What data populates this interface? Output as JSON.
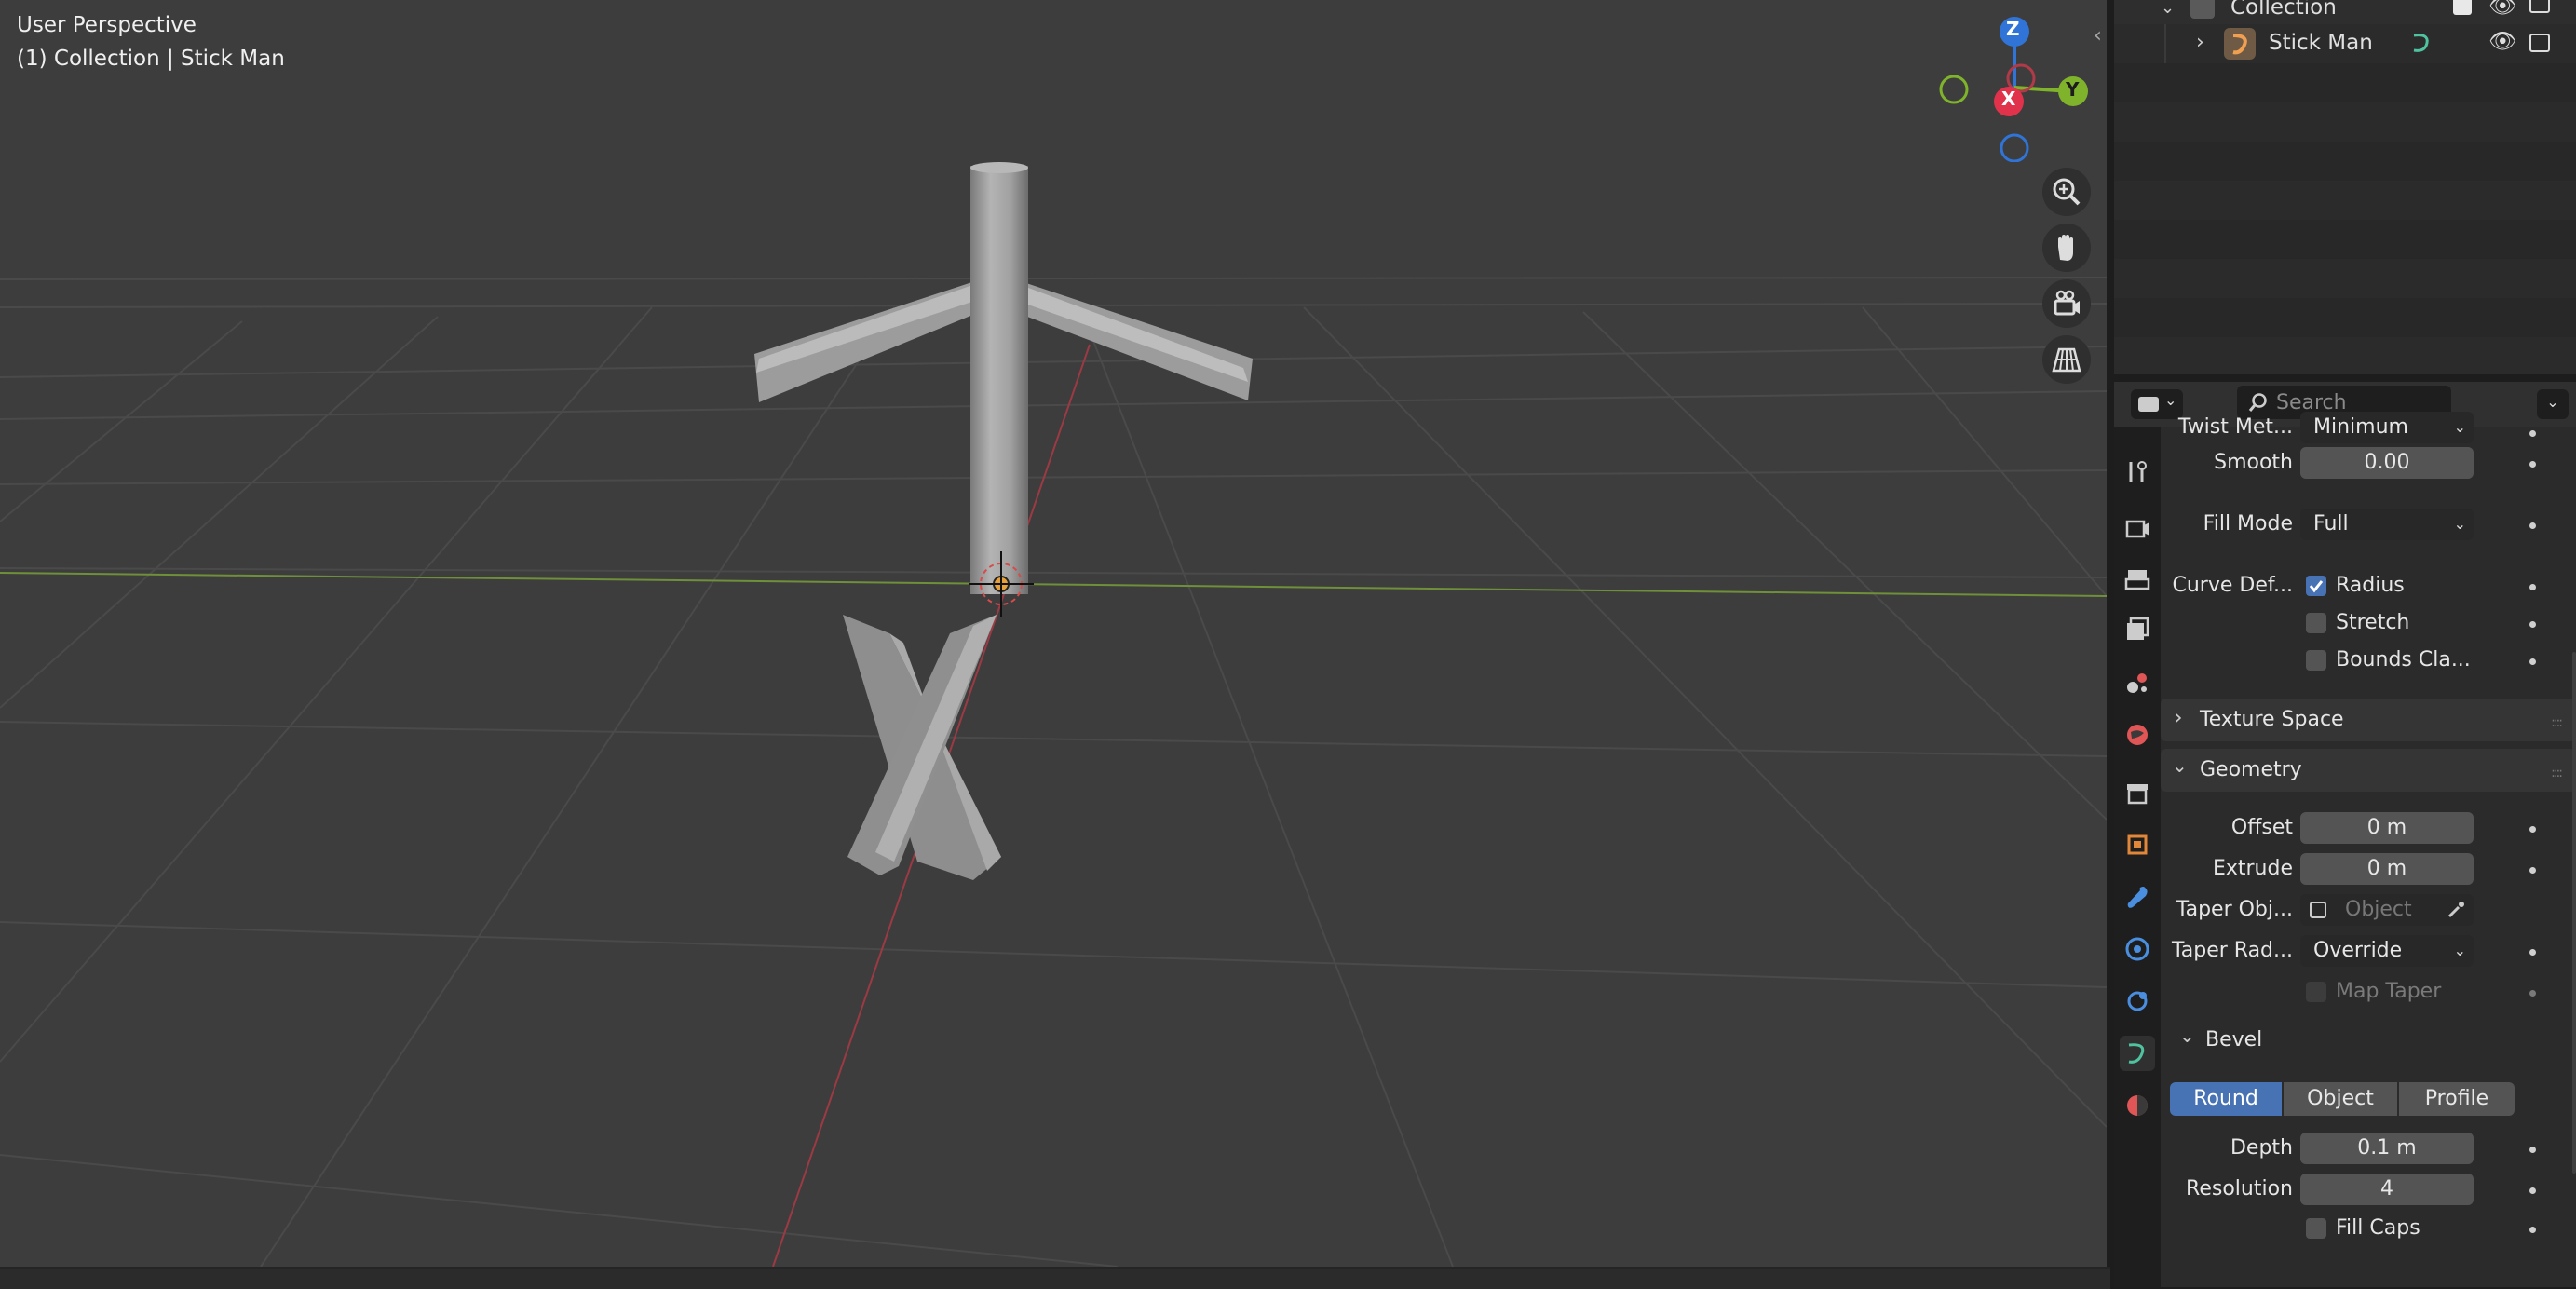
{
  "viewport": {
    "title": "User Perspective",
    "subtitle": "(1) Collection | Stick Man",
    "gizmo": {
      "z": "Z",
      "x": "X",
      "y": "Y"
    },
    "nav_icons": [
      "zoom-icon",
      "pan-hand-icon",
      "camera-view-icon",
      "grid-ortho-icon"
    ]
  },
  "outliner": {
    "collection_label": "Collection",
    "object_label": "Stick Man"
  },
  "properties": {
    "search_placeholder": "Search",
    "tabs": [
      "tool",
      "render",
      "output",
      "view-layer",
      "scene",
      "world",
      "collection",
      "object",
      "modifiers",
      "particles",
      "physics",
      "object-data-curve",
      "material"
    ],
    "shape": {
      "twist_method_label": "Twist Met...",
      "twist_method_value": "Minimum",
      "smooth_label": "Smooth",
      "smooth_value": "0.00",
      "fill_mode_label": "Fill Mode",
      "fill_mode_value": "Full",
      "curve_deform_label": "Curve Def...",
      "radius_label": "Radius",
      "radius_checked": true,
      "stretch_label": "Stretch",
      "bounds_label": "Bounds Cla..."
    },
    "texture_space_label": "Texture Space",
    "geometry": {
      "title": "Geometry",
      "offset_label": "Offset",
      "offset_value": "0 m",
      "extrude_label": "Extrude",
      "extrude_value": "0 m",
      "taper_obj_label": "Taper Obj...",
      "taper_obj_placeholder": "Object",
      "taper_rad_label": "Taper Rad...",
      "taper_rad_value": "Override",
      "map_taper_label": "Map Taper"
    },
    "bevel": {
      "title": "Bevel",
      "modes": [
        "Round",
        "Object",
        "Profile"
      ],
      "active_mode": "Round",
      "depth_label": "Depth",
      "depth_value": "0.1 m",
      "resolution_label": "Resolution",
      "resolution_value": "4",
      "fill_caps_label": "Fill Caps"
    }
  },
  "colors": {
    "accent": "#4772b3",
    "x_axis": "#e0324a",
    "y_axis": "#7fb32b",
    "z_axis": "#2f74d6"
  }
}
